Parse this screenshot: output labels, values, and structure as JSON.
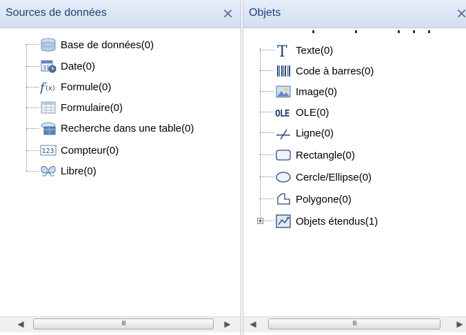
{
  "left_panel": {
    "title": "Sources de données",
    "close": "×",
    "items": [
      {
        "label": "Base de données(0)",
        "icon": "database-icon"
      },
      {
        "label": "Date(0)",
        "icon": "date-icon"
      },
      {
        "label": "Formule(0)",
        "icon": "formula-icon"
      },
      {
        "label": "Formulaire(0)",
        "icon": "form-icon"
      },
      {
        "label": "Recherche dans une table(0)",
        "icon": "table-lookup-icon"
      },
      {
        "label": "Compteur(0)",
        "icon": "counter-icon"
      },
      {
        "label": "Libre(0)",
        "icon": "free-icon"
      }
    ],
    "scroll_grip": "III"
  },
  "right_panel": {
    "title": "Objets",
    "close": "×",
    "items": [
      {
        "label": "Texte(0)",
        "icon": "text-icon"
      },
      {
        "label": "Code à barres(0)",
        "icon": "barcode-icon"
      },
      {
        "label": "Image(0)",
        "icon": "image-icon"
      },
      {
        "label": "OLE(0)",
        "icon": "ole-icon"
      },
      {
        "label": "Ligne(0)",
        "icon": "line-icon"
      },
      {
        "label": "Rectangle(0)",
        "icon": "rectangle-icon"
      },
      {
        "label": "Cercle/Ellipse(0)",
        "icon": "ellipse-icon"
      },
      {
        "label": "Polygone(0)",
        "icon": "polygon-icon"
      },
      {
        "label": "Objets étendus(1)",
        "icon": "extended-objects-icon"
      }
    ],
    "scroll_grip": "III"
  }
}
